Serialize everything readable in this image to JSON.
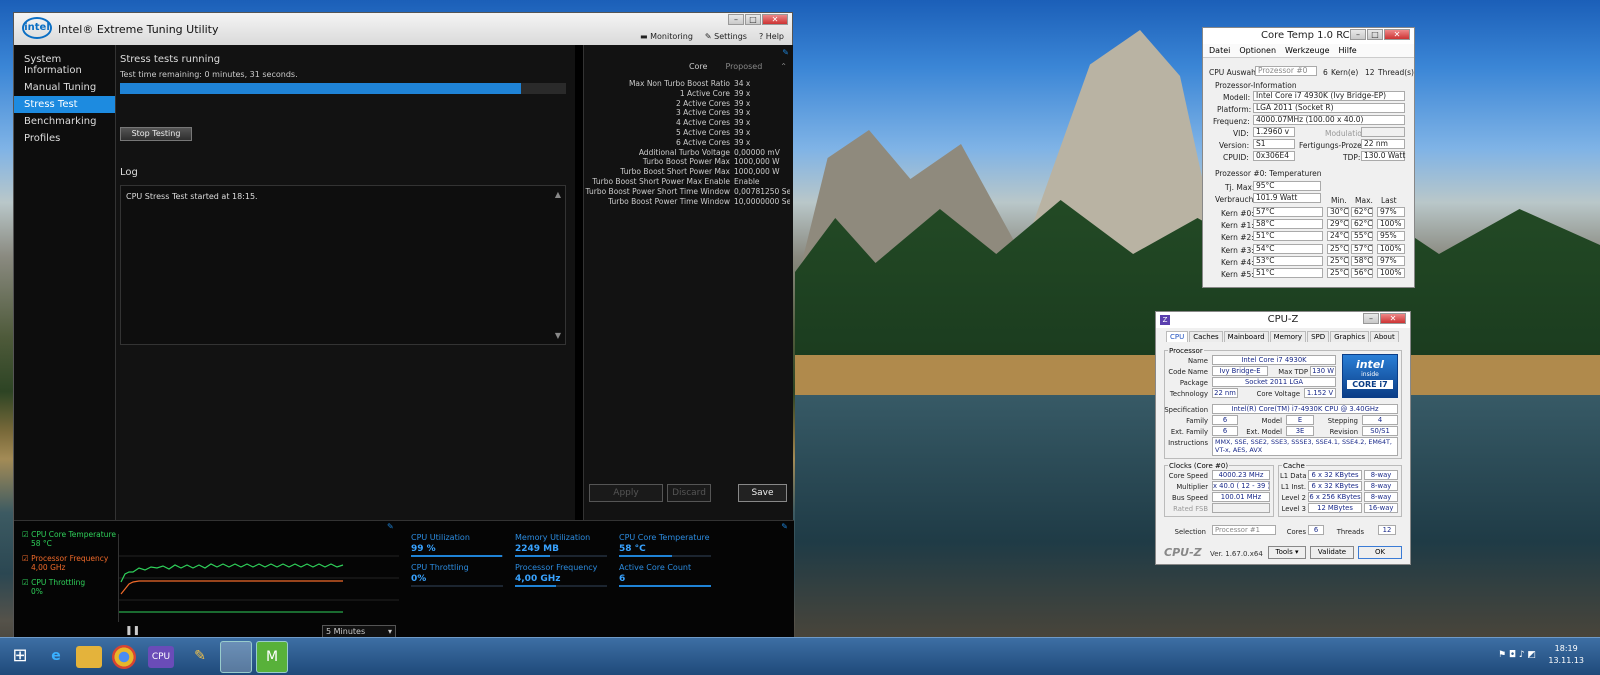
{
  "xtu": {
    "title": "Intel® Extreme Tuning Utility",
    "logo": "intel",
    "toolbar": {
      "monitoring": "Monitoring",
      "settings": "Settings",
      "help": "Help"
    },
    "nav": [
      "System Information",
      "Manual Tuning",
      "Stress Test",
      "Benchmarking",
      "Profiles"
    ],
    "active_nav": "Stress Test",
    "stress": {
      "heading": "Stress tests running",
      "remaining": "Test time remaining: 0 minutes, 31 seconds.",
      "progress_fraction": 0.9,
      "stop_label": "Stop Testing",
      "log_heading": "Log",
      "log_text": "CPU Stress Test started at 18:15."
    },
    "proposed": {
      "col_core": "Core",
      "col_proposed": "Proposed",
      "rows": [
        {
          "label": "Max Non Turbo Boost Ratio",
          "value": "34 x"
        },
        {
          "label": "1 Active Core",
          "value": "39 x"
        },
        {
          "label": "2 Active Cores",
          "value": "39 x"
        },
        {
          "label": "3 Active Cores",
          "value": "39 x"
        },
        {
          "label": "4 Active Cores",
          "value": "39 x"
        },
        {
          "label": "5 Active Cores",
          "value": "39 x"
        },
        {
          "label": "6 Active Cores",
          "value": "39 x"
        },
        {
          "label": "Additional Turbo Voltage",
          "value": "0,00000 mV"
        },
        {
          "label": "Turbo Boost Power Max",
          "value": "1000,000 W"
        },
        {
          "label": "Turbo Boost Short Power Max",
          "value": "1000,000 W"
        },
        {
          "label": "Turbo Boost Short Power Max Enable",
          "value": "Enable"
        },
        {
          "label": "Turbo Boost Power Short Time Window",
          "value": "0,00781250 Sec"
        },
        {
          "label": "Turbo Boost Power Time Window",
          "value": "10,0000000 Sec"
        }
      ],
      "apply": "Apply",
      "discard": "Discard",
      "save": "Save"
    },
    "monitor": {
      "legend": [
        {
          "name": "CPU Core Temperature",
          "value": "58 °C",
          "color": "#2fd15a"
        },
        {
          "name": "Processor Frequency",
          "value": "4,00 GHz",
          "color": "#f06a2a"
        },
        {
          "name": "CPU Throttling",
          "value": "0%",
          "color": "#2fd15a"
        }
      ],
      "range": "5 Minutes",
      "stats": [
        {
          "label": "CPU Utilization",
          "value": "99 %",
          "level": 0.99
        },
        {
          "label": "Memory Utilization",
          "value": "2249  MB",
          "level": 0.38
        },
        {
          "label": "CPU Core Temperature",
          "value": "58 °C",
          "level": 0.58
        },
        {
          "label": "CPU Throttling",
          "value": "0%",
          "level": 0
        },
        {
          "label": "Processor Frequency",
          "value": "4,00 GHz",
          "level": 0.45
        },
        {
          "label": "Active Core Count",
          "value": "6",
          "level": 1.0
        }
      ]
    }
  },
  "coretemp": {
    "title": "Core Temp 1.0 RC6",
    "menu": [
      "Datei",
      "Optionen",
      "Werkzeuge",
      "Hilfe"
    ],
    "cpu_select_label": "CPU Auswahl:",
    "cpu_select_value": "Prozessor #0",
    "cores": "6",
    "cores_label": "Kern(e)",
    "threads": "12",
    "threads_label": "Thread(s)",
    "info_heading": "Prozessor-Information",
    "model_label": "Modell:",
    "model": "Intel Core i7 4930K (Ivy Bridge-EP)",
    "platform_label": "Platform:",
    "platform": "LGA 2011 (Socket R)",
    "freq_label": "Frequenz:",
    "freq": "4000.07MHz (100.00 x 40.0)",
    "vid_label": "VID:",
    "vid": "1.2960 v",
    "modulation_label": "Modulation:",
    "version_label": "Version:",
    "version": "S1",
    "process_label": "Fertigungs-Prozess:",
    "process": "22 nm",
    "cpuid_label": "CPUID:",
    "cpuid": "0x306E4",
    "tdp_label": "TDP:",
    "tdp": "130.0 Watt",
    "temps_heading": "Prozessor #0: Temperaturen",
    "tjmax_label": "Tj. Max:",
    "tjmax": "95°C",
    "power_label": "Verbrauch:",
    "power": "101.9 Watt",
    "cols": [
      "Min.",
      "Max.",
      "Last"
    ],
    "cores_temps": [
      {
        "name": "Kern #0:",
        "temp": "57°C",
        "min": "30°C",
        "max": "62°C",
        "load": "97%"
      },
      {
        "name": "Kern #1:",
        "temp": "58°C",
        "min": "29°C",
        "max": "62°C",
        "load": "100%"
      },
      {
        "name": "Kern #2:",
        "temp": "51°C",
        "min": "24°C",
        "max": "55°C",
        "load": "95%"
      },
      {
        "name": "Kern #3:",
        "temp": "54°C",
        "min": "25°C",
        "max": "57°C",
        "load": "100%"
      },
      {
        "name": "Kern #4:",
        "temp": "53°C",
        "min": "25°C",
        "max": "58°C",
        "load": "97%"
      },
      {
        "name": "Kern #5:",
        "temp": "51°C",
        "min": "25°C",
        "max": "56°C",
        "load": "100%"
      }
    ]
  },
  "cpuz": {
    "title": "CPU-Z",
    "tabs": [
      "CPU",
      "Caches",
      "Mainboard",
      "Memory",
      "SPD",
      "Graphics",
      "About"
    ],
    "processor_group": "Processor",
    "name_label": "Name",
    "name": "Intel Core i7 4930K",
    "codename_label": "Code Name",
    "codename": "Ivy Bridge-E",
    "maxtdp_label": "Max TDP",
    "maxtdp": "130 W",
    "package_label": "Package",
    "package": "Socket 2011 LGA",
    "tech_label": "Technology",
    "tech": "22 nm",
    "cv_label": "Core Voltage",
    "cv": "1.152 V",
    "spec_label": "Specification",
    "spec": "Intel(R) Core(TM) i7-4930K CPU @ 3.40GHz",
    "family_label": "Family",
    "family": "6",
    "model_label": "Model",
    "model": "E",
    "stepping_label": "Stepping",
    "stepping": "4",
    "extfam_label": "Ext. Family",
    "extfam": "6",
    "extmodel_label": "Ext. Model",
    "extmodel": "3E",
    "revision_label": "Revision",
    "revision": "S0/S1",
    "instr_label": "Instructions",
    "instr1": "MMX, SSE, SSE2, SSE3, SSSE3, SSE4.1, SSE4.2, EM64T,",
    "instr2": "VT-x, AES, AVX",
    "badge_brand": "intel",
    "badge_inside": "inside",
    "badge_core": "CORE i7",
    "clocks_group": "Clocks (Core #0)",
    "corespeed_label": "Core Speed",
    "corespeed": "4000.23 MHz",
    "mult_label": "Multiplier",
    "mult": "x 40.0 ( 12 - 39 )",
    "bus_label": "Bus Speed",
    "bus": "100.01 MHz",
    "fsb_label": "Rated FSB",
    "cache_group": "Cache",
    "l1d_label": "L1 Data",
    "l1d": "6 x 32 KBytes",
    "l1d_way": "8-way",
    "l1i_label": "L1 Inst.",
    "l1i": "6 x 32 KBytes",
    "l1i_way": "8-way",
    "l2_label": "Level 2",
    "l2": "6 x 256 KBytes",
    "l2_way": "8-way",
    "l3_label": "Level 3",
    "l3": "12 MBytes",
    "l3_way": "16-way",
    "selection_label": "Selection",
    "selection": "Processor #1",
    "cores_label": "Cores",
    "cores": "6",
    "threads_label": "Threads",
    "threads": "12",
    "footer_brand": "CPU-Z",
    "version": "Ver. 1.67.0.x64",
    "tools": "Tools",
    "validate": "Validate",
    "ok": "OK"
  },
  "taskbar": {
    "time": "18:19",
    "date": "13.11.13"
  }
}
